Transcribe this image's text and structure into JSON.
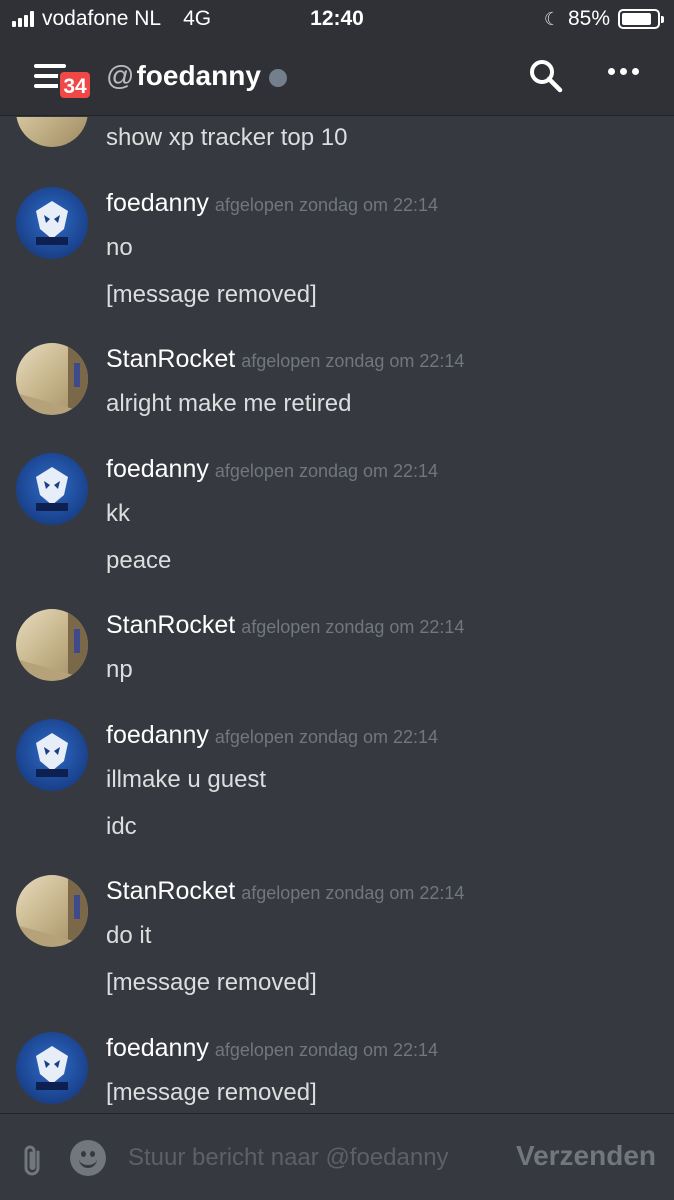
{
  "status_bar": {
    "carrier": "vodafone NL",
    "network": "4G",
    "time": "12:40",
    "battery": "85%",
    "battery_level": 0.85
  },
  "header": {
    "badge_count": "34",
    "at": "@",
    "channel_name": "foedanny",
    "status": "offline"
  },
  "messages": {
    "partial": {
      "text": "show xp tracker top 10"
    },
    "groups": [
      {
        "author": "foedanny",
        "timestamp": "afgelopen zondag om 22:14",
        "avatar": "danny",
        "lines": [
          "no",
          "[message removed]"
        ]
      },
      {
        "author": "StanRocket",
        "timestamp": "afgelopen zondag om 22:14",
        "avatar": "stan",
        "lines": [
          "alright make me retired"
        ]
      },
      {
        "author": "foedanny",
        "timestamp": "afgelopen zondag om 22:14",
        "avatar": "danny",
        "lines": [
          "kk",
          "peace"
        ]
      },
      {
        "author": "StanRocket",
        "timestamp": "afgelopen zondag om 22:14",
        "avatar": "stan",
        "lines": [
          "np"
        ]
      },
      {
        "author": "foedanny",
        "timestamp": "afgelopen zondag om 22:14",
        "avatar": "danny",
        "lines": [
          "illmake u guest",
          "idc"
        ]
      },
      {
        "author": "StanRocket",
        "timestamp": "afgelopen zondag om 22:14",
        "avatar": "stan",
        "lines": [
          "do it",
          "[message removed]"
        ]
      },
      {
        "author": "foedanny",
        "timestamp": "afgelopen zondag om 22:14",
        "avatar": "danny",
        "lines": [
          "[message removed]"
        ]
      }
    ]
  },
  "composer": {
    "placeholder": "Stuur bericht naar @foedanny",
    "send_label": "Verzenden"
  },
  "icons": {
    "menu": "hamburger-icon",
    "search": "search-icon",
    "more": "more-icon",
    "attach": "paperclip-icon",
    "emoji": "emoji-icon"
  },
  "colors": {
    "background": "#36393f",
    "header": "#2f3136",
    "badge": "#f04747",
    "timestamp": "#72767d"
  }
}
